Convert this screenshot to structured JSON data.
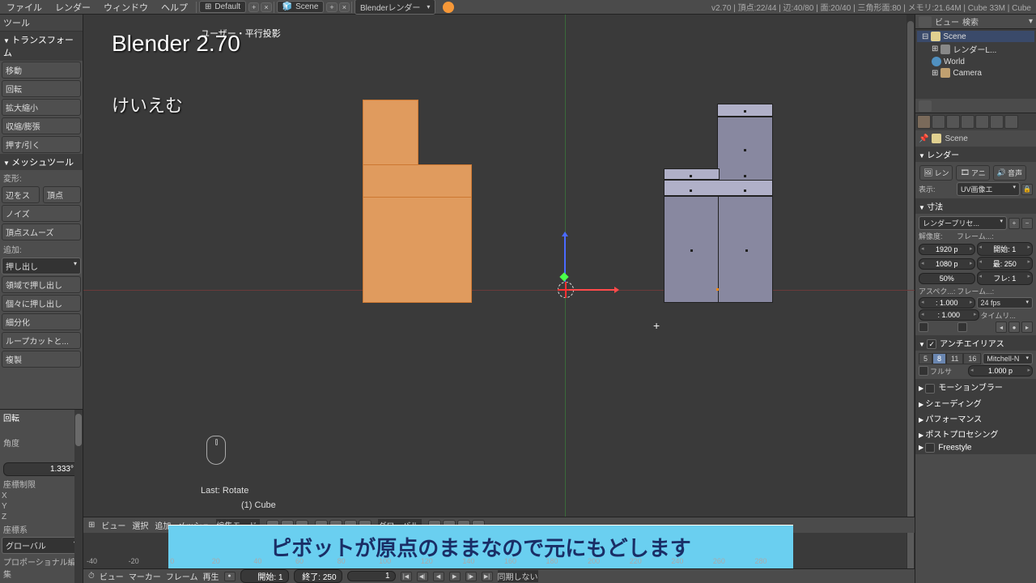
{
  "topbar": {
    "menus": [
      "ファイル",
      "レンダー",
      "ウィンドウ",
      "ヘルプ"
    ],
    "layout_label": "Default",
    "scene_label": "Scene",
    "engine_label": "Blenderレンダー",
    "stats": "v2.70 | 頂点:22/44 | 辺:40/80 | 面:20/40 | 三角形面:80 | メモリ:21.64M | Cube    33M | Cube"
  },
  "toolshelf": {
    "tab_tools": "ツール",
    "panel_transform": "トランスフォーム",
    "move": "移動",
    "rotate": "回転",
    "scale": "拡大縮小",
    "shrink": "収縮/膨張",
    "pushpull": "押す/引く",
    "panel_mesh": "メッシュツール",
    "deform": "変形:",
    "edge_slide": "辺をス",
    "vert_slide": "頂点",
    "noise": "ノイズ",
    "smooth_vertex": "頂点スムーズ",
    "add": "追加:",
    "extrude_sel": "押し出し",
    "extrude_region": "領域で押し出し",
    "extrude_indiv": "個々に押し出し",
    "subdivide": "細分化",
    "loopcut": "ループカットと...",
    "duplicate": "複製"
  },
  "operator": {
    "title": "回転",
    "angle_label": "角度",
    "angle_value": "1.333°",
    "constraint": "座標制限",
    "x": "X",
    "y": "Y",
    "z": "Z",
    "orientation": "座標系",
    "orient_val": "グローバル",
    "prop_edit": "プロポーショナル編集"
  },
  "viewport": {
    "header": "ユーザー・平行投影",
    "watermark1": "Blender 2.70",
    "watermark2": "けいえむ",
    "last_op": "Last: Rotate",
    "object": "(1) Cube"
  },
  "viewport_bar": {
    "view": "ビュー",
    "select": "選択",
    "add": "追加",
    "mesh": "メッシュ",
    "mode": "編集モード",
    "global": "グローバル"
  },
  "subtitle": "ピボットが原点のままなので元にもどします",
  "timeline": {
    "view": "ビュー",
    "marker": "マーカー",
    "frame": "フレーム",
    "playback": "再生",
    "start_lbl": "開始:",
    "start_val": "1",
    "end_lbl": "終了:",
    "end_val": "250",
    "cur_val": "1",
    "sync": "同期しない",
    "ticks": [
      "-40",
      "-20",
      "0",
      "20",
      "40",
      "60",
      "80",
      "100",
      "120",
      "140",
      "160",
      "180",
      "200",
      "220",
      "240",
      "260",
      "280"
    ]
  },
  "outliner": {
    "view": "ビュー",
    "search": "検索",
    "scene": "Scene",
    "render_layers": "レンダーL...",
    "world": "World",
    "camera": "Camera"
  },
  "props": {
    "scene_crumb": "Scene",
    "render": "レンダー",
    "btn_render": "レン",
    "btn_anim": "アニ",
    "btn_audio": "音声",
    "display_lbl": "表示:",
    "display_val": "UV画像エ",
    "dimensions": "寸法",
    "preset": "レンダープリセ...",
    "res_lbl": "解像度:",
    "frame_lbl": "フレーム...:",
    "res_x": "1920 p",
    "res_y": "1080 p",
    "res_pct": "50%",
    "start_lbl": "開始:",
    "start": "1",
    "end_lbl": "最:",
    "end": "250",
    "step_lbl": "フレ:",
    "step": "1",
    "aspect_lbl": "アスペク...:",
    "fps_lbl": "フレーム...:",
    "aspect_x": ": 1.000",
    "aspect_y": ": 1.000",
    "fps": "24 fps",
    "time_remap": "タイムリ...",
    "aa": "アンチエイリアス",
    "aa_5": "5",
    "aa_8": "8",
    "aa_11": "11",
    "aa_16": "16",
    "filter": "Mitchell-N",
    "full_sample": "フルサ",
    "filter_size": "1.000 p",
    "motion_blur": "モーションブラー",
    "shading": "シェーディング",
    "performance": "パフォーマンス",
    "post_proc": "ポストプロセシング",
    "freestyle": "Freestyle"
  }
}
